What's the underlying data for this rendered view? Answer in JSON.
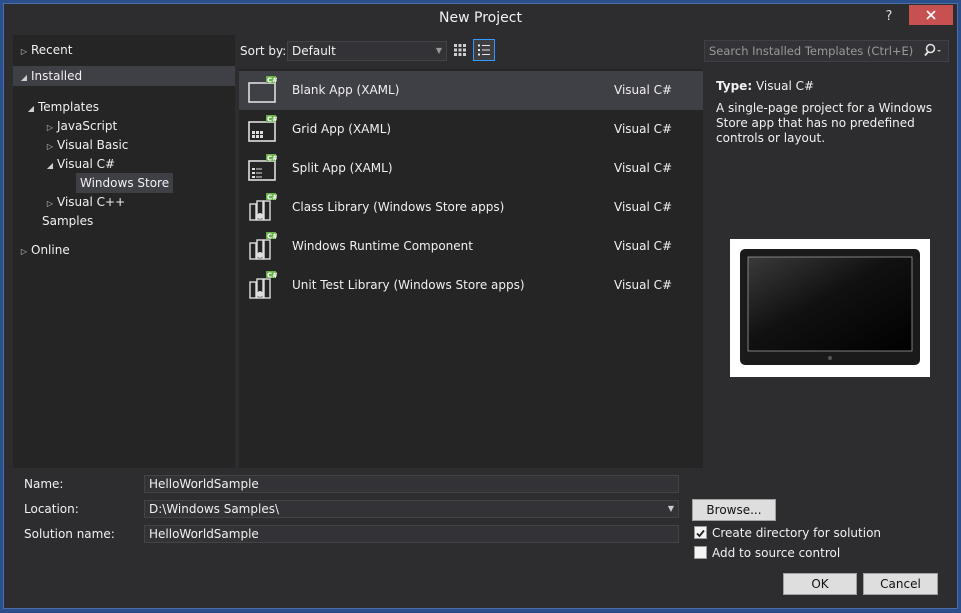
{
  "window": {
    "title": "New Project",
    "help": "?"
  },
  "tree": {
    "recent": "Recent",
    "installed": "Installed",
    "templates": "Templates",
    "javascript": "JavaScript",
    "visual_basic": "Visual Basic",
    "visual_csharp": "Visual C#",
    "windows_store": "Windows Store",
    "visual_cpp": "Visual C++",
    "samples": "Samples",
    "online": "Online"
  },
  "toolbar": {
    "sort_label": "Sort by:",
    "sort_value": "Default",
    "search_placeholder": "Search Installed Templates (Ctrl+E)"
  },
  "templates": [
    {
      "name": "Blank App (XAML)",
      "lang": "Visual C#",
      "icon": "blank-app-icon"
    },
    {
      "name": "Grid App (XAML)",
      "lang": "Visual C#",
      "icon": "grid-app-icon"
    },
    {
      "name": "Split App (XAML)",
      "lang": "Visual C#",
      "icon": "split-app-icon"
    },
    {
      "name": "Class Library (Windows Store apps)",
      "lang": "Visual C#",
      "icon": "class-library-icon"
    },
    {
      "name": "Windows Runtime Component",
      "lang": "Visual C#",
      "icon": "runtime-component-icon"
    },
    {
      "name": "Unit Test Library (Windows Store apps)",
      "lang": "Visual C#",
      "icon": "unit-test-icon"
    }
  ],
  "details": {
    "type_label": "Type:",
    "type_value": "Visual C#",
    "description": "A single-page project for a Windows Store app that has no predefined controls or layout."
  },
  "form": {
    "name_label": "Name:",
    "name_value": "HelloWorldSample",
    "location_label": "Location:",
    "location_value": "D:\\Windows Samples\\",
    "solution_label": "Solution name:",
    "solution_value": "HelloWorldSample",
    "browse": "Browse...",
    "create_dir": "Create directory for solution",
    "create_dir_checked": true,
    "source_control": "Add to source control",
    "source_control_checked": false,
    "ok": "OK",
    "cancel": "Cancel"
  },
  "colors": {
    "accent": "#3399ff",
    "close": "#c75050",
    "csharp_badge": "#68b04a"
  }
}
